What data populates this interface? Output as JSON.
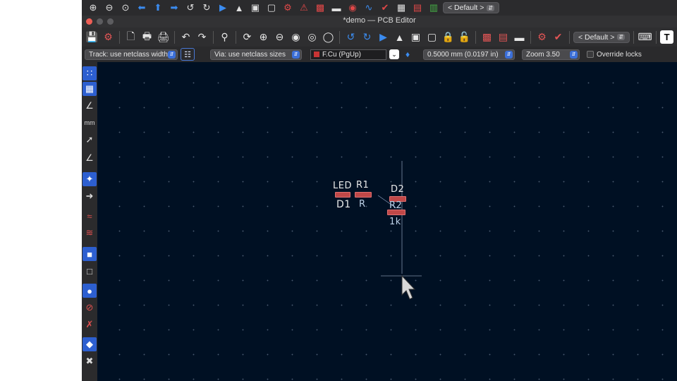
{
  "app": {
    "title": "*demo — PCB Editor"
  },
  "top_strip": {
    "preset_label": "< Default >",
    "icons": [
      "zoom-in-icon",
      "zoom-out-icon",
      "zoom-fit-icon",
      "arrow-left-icon",
      "arrow-up-icon",
      "arrow-right-icon",
      "rotate-ccw-icon",
      "rotate-cw-icon",
      "mirror-h-icon",
      "mirror-v-icon",
      "group-icon",
      "ungroup-icon",
      "inspector-icon",
      "drc-icon",
      "footprint-icon",
      "r42-annotate-icon",
      "net-inspect-icon",
      "simulator-icon",
      "erc-icon",
      "table-icon",
      "bom-icon",
      "pcb-switch-icon"
    ]
  },
  "main_toolbar": {
    "preset_label": "< Default >",
    "text_button": "T"
  },
  "options_bar": {
    "track_width": "Track: use netclass width",
    "via_size": "Via: use netclass sizes",
    "layer": "F.Cu (PgUp)",
    "grid": "0.5000 mm (0.0197 in)",
    "zoom": "Zoom 3.50",
    "override_locks": "Override locks",
    "layer_color": "#c83434"
  },
  "board": {
    "components": [
      {
        "ref": "LED",
        "value": "D1"
      },
      {
        "ref": "R1",
        "value": "R"
      },
      {
        "ref": "D2",
        "value": "R2"
      },
      {
        "ref": "",
        "value": "1k"
      }
    ]
  },
  "colors": {
    "canvas": "#001023",
    "pad": "#c04848",
    "accent": "#2d5fd0"
  }
}
